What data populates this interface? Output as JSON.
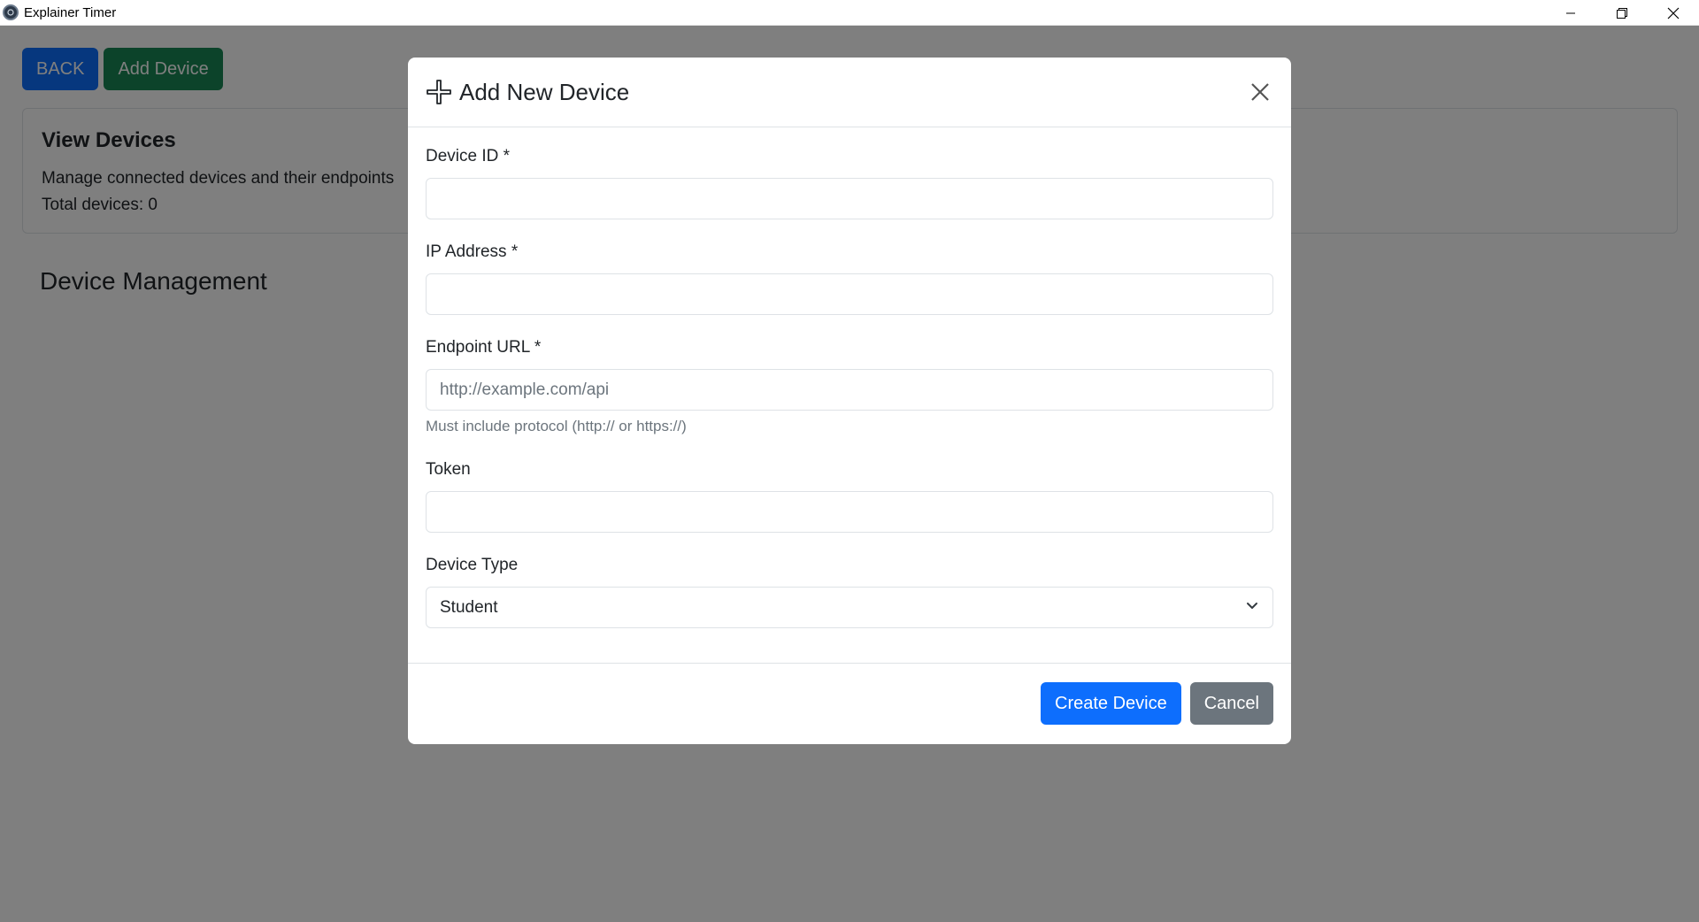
{
  "window": {
    "title": "Explainer Timer",
    "controls": [
      "minimize-icon",
      "restore-icon",
      "close-icon"
    ]
  },
  "toolbar": {
    "back_label": "BACK",
    "add_device_label": "Add Device"
  },
  "card": {
    "title": "View Devices",
    "description": "Manage connected devices and their endpoints",
    "total": "Total devices: 0"
  },
  "section": {
    "title": "Device Management"
  },
  "modal": {
    "title": "Add New Device",
    "icon": "plus-icon",
    "fields": {
      "device_id": {
        "label": "Device ID *",
        "value": "",
        "placeholder": ""
      },
      "ip_address": {
        "label": "IP Address *",
        "value": "",
        "placeholder": ""
      },
      "endpoint_url": {
        "label": "Endpoint URL *",
        "value": "",
        "placeholder": "http://example.com/api",
        "help": "Must include protocol (http:// or https://)"
      },
      "token": {
        "label": "Token",
        "value": "",
        "placeholder": ""
      },
      "device_type": {
        "label": "Device Type",
        "selected": "Student"
      }
    },
    "create_label": "Create Device",
    "cancel_label": "Cancel"
  },
  "colors": {
    "primary": "#0d6efd",
    "success": "#198754",
    "secondary": "#6c757d",
    "backdrop": "rgba(0,0,0,0.5)"
  }
}
